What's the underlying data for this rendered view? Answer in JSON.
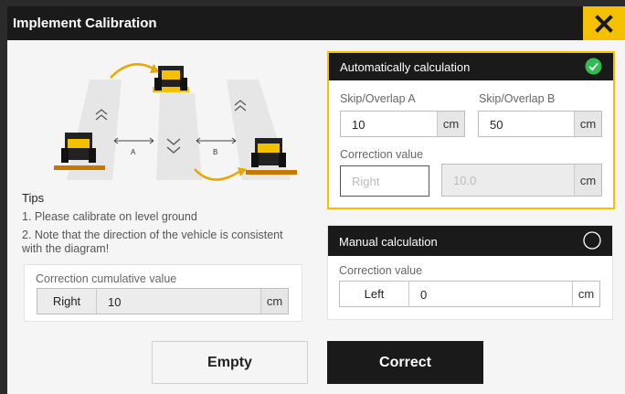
{
  "dialog": {
    "title": "Implement Calibration",
    "close_icon": "close-x-icon"
  },
  "diagram": {
    "label_a": "A",
    "label_b": "B"
  },
  "tips": {
    "title": "Tips",
    "items": [
      "1. Please calibrate on level ground",
      "2. Note that the direction of the vehicle is consistent with the diagram!"
    ]
  },
  "cumulative": {
    "label": "Correction cumulative value",
    "direction": "Right",
    "value": "10",
    "unit": "cm"
  },
  "auto": {
    "title": "Automatically calculation",
    "selected": true,
    "skip_a": {
      "label": "Skip/Overlap A",
      "value": "10",
      "unit": "cm"
    },
    "skip_b": {
      "label": "Skip/Overlap B",
      "value": "50",
      "unit": "cm"
    },
    "correction": {
      "label": "Correction value",
      "direction_placeholder": "Right",
      "value_placeholder": "10.0",
      "unit": "cm"
    }
  },
  "manual": {
    "title": "Manual calculation",
    "selected": false,
    "correction": {
      "label": "Correction value",
      "direction": "Left",
      "value": "0",
      "unit": "cm"
    }
  },
  "buttons": {
    "empty": "Empty",
    "correct": "Correct"
  },
  "colors": {
    "accent": "#f5c000",
    "dark": "#1a1a1a",
    "check": "#2ebd4e"
  }
}
